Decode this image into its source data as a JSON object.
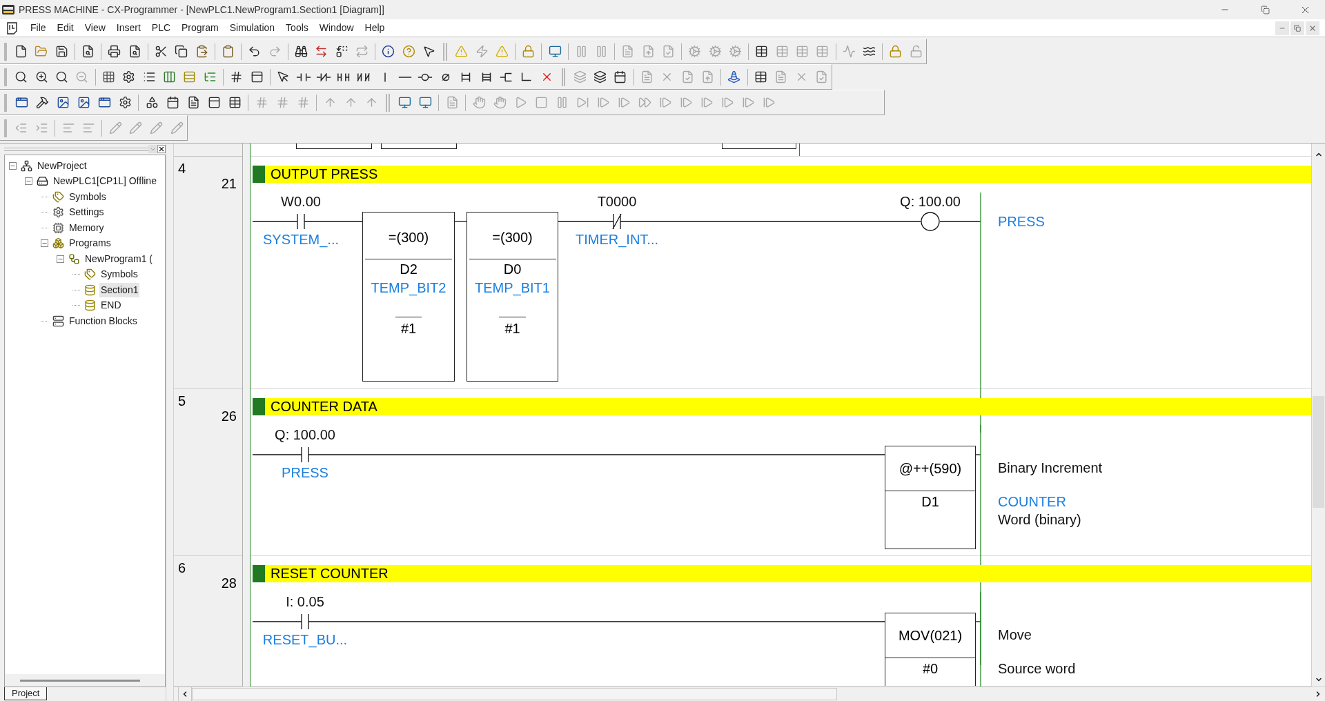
{
  "window": {
    "title": "PRESS MACHINE - CX-Programmer - [NewPLC1.NewProgram1.Section1 [Diagram]]"
  },
  "menu": [
    "File",
    "Edit",
    "View",
    "Insert",
    "PLC",
    "Program",
    "Simulation",
    "Tools",
    "Window",
    "Help"
  ],
  "project_tree": {
    "items": [
      {
        "label": "NewProject",
        "kind": "project",
        "expanded": true,
        "selected": false,
        "children": [
          {
            "label": "NewPLC1[CP1L] Offline",
            "kind": "plc",
            "expanded": true,
            "selected": false,
            "children": [
              {
                "label": "Symbols",
                "kind": "symbols",
                "selected": false
              },
              {
                "label": "Settings",
                "kind": "settings",
                "selected": false
              },
              {
                "label": "Memory",
                "kind": "memory",
                "selected": false
              },
              {
                "label": "Programs",
                "kind": "programs",
                "expanded": true,
                "selected": false,
                "children": [
                  {
                    "label": "NewProgram1 (",
                    "kind": "program",
                    "expanded": true,
                    "selected": false,
                    "children": [
                      {
                        "label": "Symbols",
                        "kind": "symbols",
                        "selected": false
                      },
                      {
                        "label": "Section1",
                        "kind": "section",
                        "selected": true
                      },
                      {
                        "label": "END",
                        "kind": "section",
                        "selected": false
                      }
                    ]
                  }
                ]
              },
              {
                "label": "Function Blocks",
                "kind": "function_blocks",
                "selected": false
              }
            ]
          }
        ]
      }
    ]
  },
  "panel_tabs": [
    {
      "label": "Project",
      "selected": true
    }
  ],
  "rungs": [
    {
      "number": "4",
      "step": "21",
      "comment": "OUTPUT PRESS",
      "elements": [
        {
          "kind": "contact_no",
          "address": "W0.00",
          "symbol": "SYSTEM_..."
        },
        {
          "kind": "compare",
          "instruction": "=(300)",
          "operand": "D2",
          "symbol": "TEMP_BIT2",
          "constant": "#1"
        },
        {
          "kind": "compare",
          "instruction": "=(300)",
          "operand": "D0",
          "symbol": "TEMP_BIT1",
          "constant": "#1"
        },
        {
          "kind": "contact_nc",
          "address": "T0000",
          "symbol": "TIMER_INT..."
        },
        {
          "kind": "coil",
          "address": "Q: 100.00",
          "symbol": "PRESS"
        }
      ]
    },
    {
      "number": "5",
      "step": "26",
      "comment": "COUNTER DATA",
      "elements": [
        {
          "kind": "contact_no",
          "address": "Q: 100.00",
          "symbol": "PRESS"
        },
        {
          "kind": "block",
          "instruction": "@++(590)",
          "operand": "D1",
          "notes": [
            {
              "kind": "description",
              "text": "Binary Increment"
            },
            {
              "kind": "symbol",
              "text": "COUNTER"
            },
            {
              "kind": "description",
              "text": "Word (binary)"
            }
          ]
        }
      ]
    },
    {
      "number": "6",
      "step": "28",
      "comment": "RESET COUNTER",
      "elements": [
        {
          "kind": "contact_no",
          "address": "I: 0.05",
          "symbol": "RESET_BU..."
        },
        {
          "kind": "block",
          "instruction": "MOV(021)",
          "operand": "#0",
          "notes": [
            {
              "kind": "description",
              "text": "Move"
            },
            {
              "kind": "description",
              "text": "Source word"
            }
          ]
        }
      ]
    }
  ]
}
